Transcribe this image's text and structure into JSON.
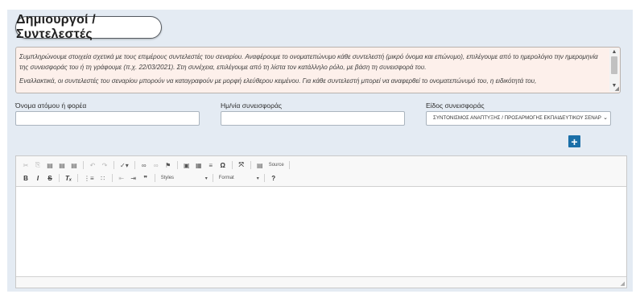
{
  "section": {
    "title": "Δημιουργοί / Συντελεστές"
  },
  "info": {
    "paragraphs": [
      "Συμπληρώνουμε στοιχεία σχετικά με τους επιμέρους συντελεστές του σεναρίου. Αναφέρουμε το ονοματεπώνυμο κάθε συντελεστή (μικρό όνομα και επώνυμο), επιλέγουμε από το ημερολόγιο την ημερομηνία της συνεισφοράς του ή τη γράφουμε (π.χ. 22/03/2021). Στη συνέχεια, επιλέγουμε από τη λίστα τον κατάλληλο ρόλο, με βάση τη συνεισφορά του.",
      "Εναλλακτικά, οι συντελεστές του σεναρίου μπορούν να καταγραφούν με μορφή ελεύθερου κειμένου. Για κάθε συντελεστή μπορεί να αναφερθεί το ονοματεπώνυμό του, η ειδικότητά του,"
    ]
  },
  "form": {
    "person_label": "Όνομα ατόμου ή φορέα",
    "person_value": "",
    "date_label": "Ημ/νία συνεισφοράς",
    "date_value": "",
    "type_label": "Είδος συνεισφοράς",
    "type_selected": "ΣΥΝΤΟΝΙΣΜΟΣ ΑΝΑΠΤΥΞΗΣ / ΠΡΟΣΑΡΜΟΓΗΣ ΕΚΠΑΙΔΕΥΤΙΚΟΥ ΣΕΝΑΡ",
    "add_label": "+"
  },
  "editor": {
    "source_label": "Source",
    "styles_label": "Styles",
    "format_label": "Format",
    "content": ""
  },
  "colors": {
    "panel_bg": "#e4ebf3",
    "info_bg": "#fdf0eb",
    "accent": "#1a6fa8"
  }
}
